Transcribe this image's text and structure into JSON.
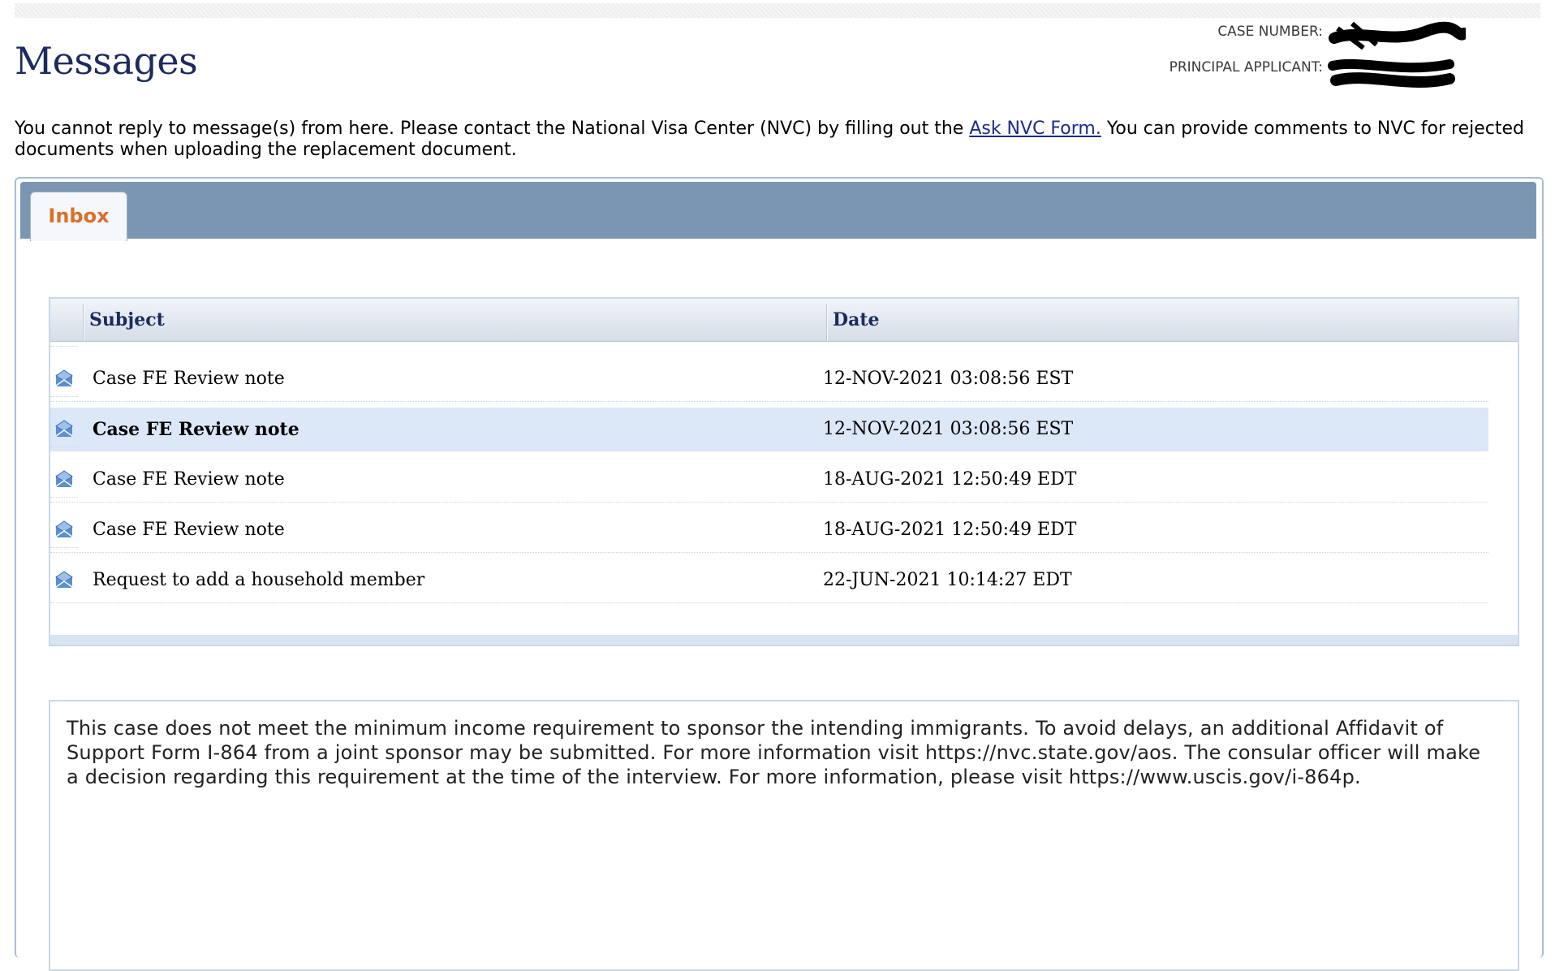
{
  "page": {
    "title": "Messages",
    "intro_before_link": "You cannot reply to message(s) from here.  Please contact the National Visa Center (NVC) by filling out the ",
    "intro_link": "Ask NVC Form.",
    "intro_after_link": "  You can provide comments to NVC for rejected documents when uploading the replacement document."
  },
  "case_info": {
    "case_number_label": "CASE NUMBER:",
    "principal_applicant_label": "PRINCIPAL APPLICANT:"
  },
  "tabs": [
    {
      "label": "Inbox",
      "active": true
    }
  ],
  "table": {
    "headers": {
      "subject": "Subject",
      "date": "Date"
    },
    "rows": [
      {
        "subject": "Case FE Review note",
        "date": "12-NOV-2021 03:08:56 EST",
        "selected": false
      },
      {
        "subject": "Case FE Review note",
        "date": "12-NOV-2021 03:08:56 EST",
        "selected": true
      },
      {
        "subject": "Case FE Review note",
        "date": "18-AUG-2021 12:50:49 EDT",
        "selected": false
      },
      {
        "subject": "Case FE Review note",
        "date": "18-AUG-2021 12:50:49 EDT",
        "selected": false
      },
      {
        "subject": "Request to add a household member",
        "date": "22-JUN-2021 10:14:27 EDT",
        "selected": false
      }
    ]
  },
  "message_body": "This case does not meet the minimum income requirement to sponsor the intending immigrants. To avoid delays, an additional Affidavit of Support Form I-864 from a joint sponsor may be submitted. For more information visit https://nvc.state.gov/aos. The consular officer will make a decision regarding this requirement at the time of the interview. For more information, please visit https://www.uscis.gov/i-864p.",
  "colors": {
    "title": "#1c2b5e",
    "tab_bar": "#7b96b2",
    "tab_label": "#d9702a",
    "selected_row": "#dce7f8",
    "icon": "#5b8fd0"
  },
  "icons": {
    "message_row": "envelope-open-icon"
  }
}
